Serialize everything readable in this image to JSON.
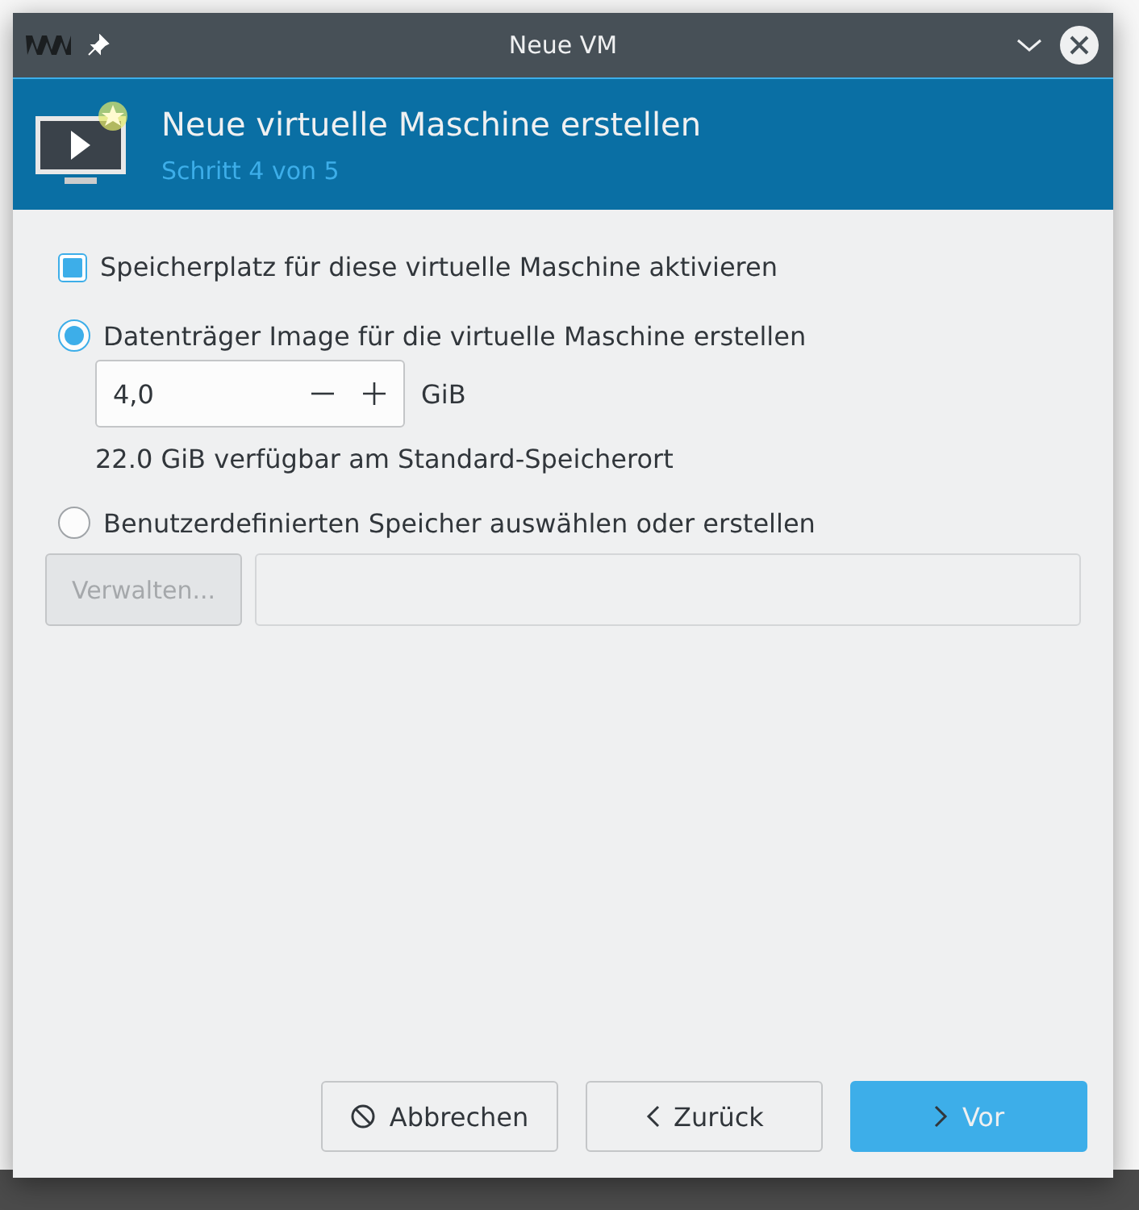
{
  "window": {
    "title": "Neue VM"
  },
  "header": {
    "title": "Neue virtuelle Maschine erstellen",
    "subtitle": "Schritt 4 von 5"
  },
  "storage_checkbox": {
    "label": "Speicherplatz für diese virtuelle Maschine aktivieren",
    "checked": true
  },
  "options": [
    {
      "kind": "create",
      "label": "Datenträger Image für die virtuelle Maschine erstellen",
      "selected": true,
      "size": {
        "value": "4,0",
        "unit": "GiB"
      },
      "available": "22.0 GiB verfügbar am Standard-Speicherort"
    },
    {
      "kind": "custom",
      "label": "Benutzerdefinierten Speicher auswählen oder erstellen",
      "selected": false,
      "manage_button": {
        "label": "Verwalten...",
        "disabled": true
      }
    }
  ],
  "buttons": [
    {
      "kind": "cancel",
      "label": "Abbrechen"
    },
    {
      "kind": "back",
      "label": "Zurück"
    },
    {
      "kind": "next",
      "label": "Vor"
    }
  ]
}
